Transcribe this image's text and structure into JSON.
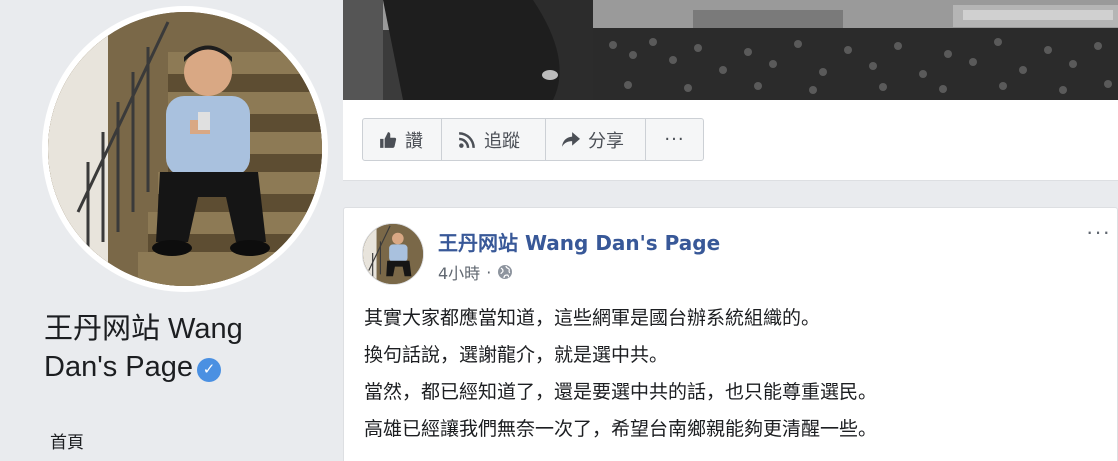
{
  "page": {
    "name_line1": "王丹网站 Wang",
    "name_line2": "Dan's Page",
    "verified": true
  },
  "nav": {
    "home_label": "首頁"
  },
  "actions": {
    "like_label": "讚",
    "follow_label": "追蹤",
    "share_label": "分享",
    "more_label": "···"
  },
  "post": {
    "author": "王丹网站 Wang Dan's Page",
    "time": "4小時",
    "separator": "·",
    "options_label": "···",
    "lines": [
      "其實大家都應當知道，這些網軍是國台辦系統組織的。",
      "換句話說，選謝龍介，就是選中共。",
      "當然，都已經知道了，還是要選中共的話，也只能尊重選民。",
      "高雄已經讓我們無奈一次了，希望台南鄉親能夠更清醒一些。"
    ]
  },
  "colors": {
    "background": "#e9ebee",
    "link_blue": "#385898",
    "verified_blue": "#4a90e2",
    "button_bg": "#f5f6f7"
  },
  "icons": [
    "thumbs-up-icon",
    "rss-icon",
    "share-arrow-icon",
    "more-icon",
    "globe-icon",
    "verified-badge-icon"
  ]
}
